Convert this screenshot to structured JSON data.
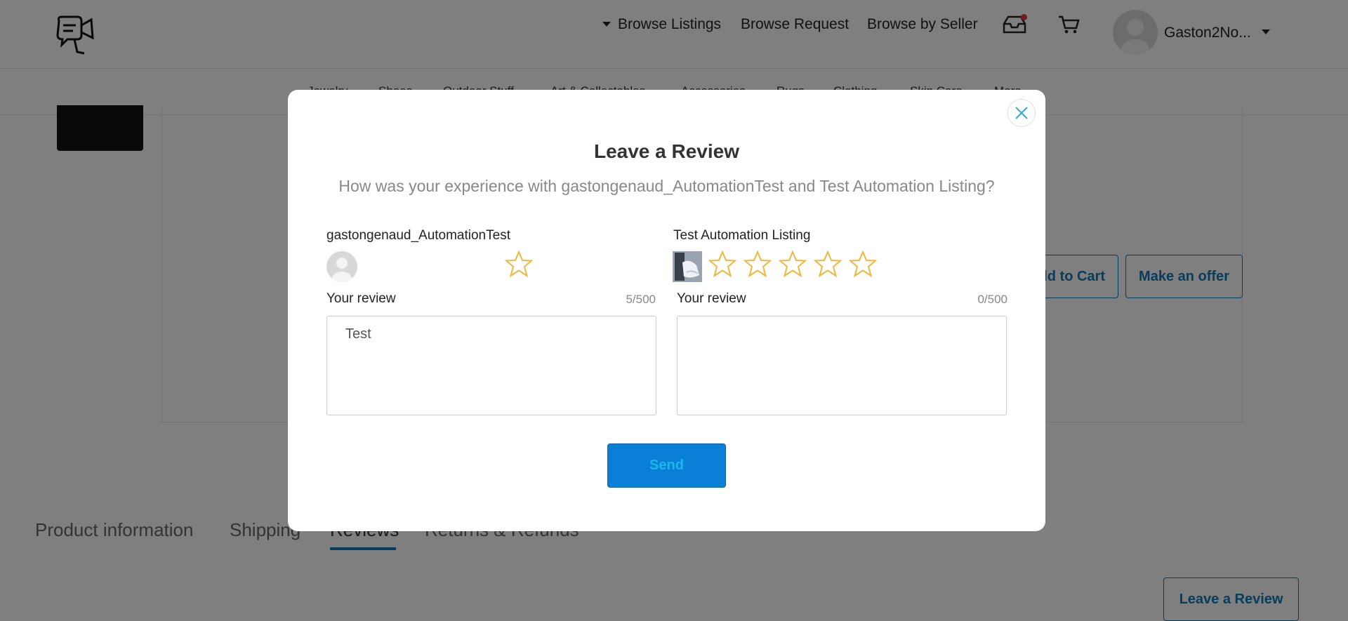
{
  "header": {
    "nav": [
      "Browse Listings",
      "Browse Request",
      "Browse by Seller"
    ],
    "username": "Gaston2No...",
    "icons": [
      "inbox-icon",
      "cart-icon",
      "avatar"
    ]
  },
  "categories": [
    "Jewelry",
    "Shoes",
    "Outdoor Stuff",
    "Art & Collectables",
    "Accessories",
    "Rugs",
    "Clothing",
    "Skin Care",
    "More"
  ],
  "product": {
    "add_to_cart": "Add to Cart",
    "make_offer": "Make an offer"
  },
  "tabs": [
    "Product information",
    "Shipping",
    "Reviews",
    "Returns & Refunds"
  ],
  "leave_review_button": "Leave a Review",
  "modal": {
    "title": "Leave a Review",
    "subtitle": "How was your experience with gastongenaud_AutomationTest and Test Automation Listing?",
    "seller": {
      "name": "gastongenaud_AutomationTest",
      "rating": 0,
      "stars_shown": 1,
      "review_label": "Your review",
      "counter": "5/500",
      "review_value": "Test"
    },
    "listing": {
      "name": "Test Automation Listing",
      "rating": 0,
      "stars_shown": 5,
      "review_label": "Your review",
      "counter": "0/500",
      "review_value": ""
    },
    "send_label": "Send"
  },
  "colors": {
    "accent": "#0d7bb8",
    "star": "#f0b73c",
    "send_bg": "#0a7fd8"
  }
}
